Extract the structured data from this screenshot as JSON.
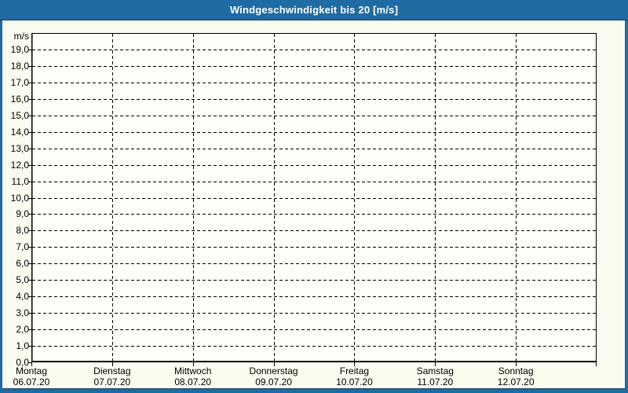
{
  "title": "Windgeschwindigkeit bis 20 [m/s]",
  "colors": {
    "titlebar": "#1E6CA3",
    "border_dark": "#0F3D61",
    "content_bg": "#FAFCEF",
    "plot_bg": "#FDFEF7",
    "grid": "#000000",
    "title_text": "#FFFFFF",
    "label_text": "#000000"
  },
  "chart_data": {
    "type": "line",
    "title": "Windgeschwindigkeit bis 20 [m/s]",
    "y_unit": "m/s",
    "ylabel": "m/s",
    "ylim": [
      0,
      20
    ],
    "ytick_step": 1.0,
    "ytick_labels": [
      "0,0",
      "1,0",
      "2,0",
      "3,0",
      "4,0",
      "5,0",
      "6,0",
      "7,0",
      "8,0",
      "9,0",
      "10,0",
      "11,0",
      "12,0",
      "13,0",
      "14,0",
      "15,0",
      "16,0",
      "17,0",
      "18,0",
      "19,0"
    ],
    "x_days": [
      {
        "name": "Montag",
        "date": "06.07.20"
      },
      {
        "name": "Dienstag",
        "date": "07.07.20"
      },
      {
        "name": "Mittwoch",
        "date": "08.07.20"
      },
      {
        "name": "Donnerstag",
        "date": "09.07.20"
      },
      {
        "name": "Freitag",
        "date": "10.07.20"
      },
      {
        "name": "Samstag",
        "date": "11.07.20"
      },
      {
        "name": "Sonntag",
        "date": "12.07.20"
      }
    ],
    "grid": "dashed",
    "legend": null,
    "series": []
  }
}
